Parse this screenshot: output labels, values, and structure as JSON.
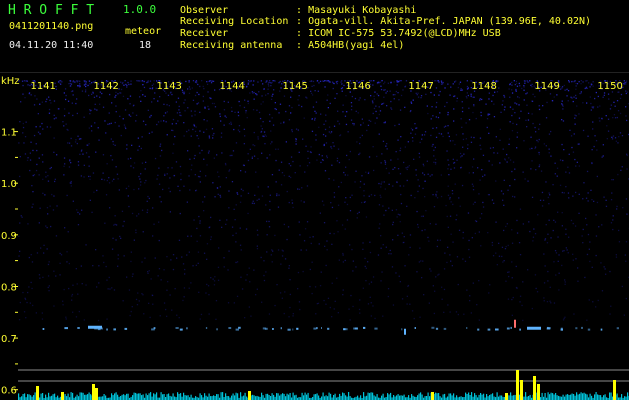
{
  "app": {
    "title": "H R O F F T",
    "version": "1.0.0",
    "filename": "0411201140.png",
    "datetime": "04.11.20 11:40",
    "count_label": "meteor",
    "count_value": "18"
  },
  "info": [
    {
      "label": "Observer",
      "sep": ":",
      "value": "Masayuki Kobayashi"
    },
    {
      "label": "Receiving Location",
      "sep": ":",
      "value": "Ogata-vill. Akita-Pref. JAPAN (139.96E, 40.02N)"
    },
    {
      "label": "Receiver",
      "sep": ":",
      "value": "ICOM IC-575 53.7492(@LCD)MHz USB"
    },
    {
      "label": "Receiving antenna",
      "sep": ":",
      "value": "A504HB(yagi 4el)"
    }
  ],
  "spectrogram": {
    "y_unit": "kHz",
    "y_ticks": [
      "1.1",
      "1.0",
      "0.9",
      "0.8",
      "0.7",
      "0.6"
    ],
    "y_tick_values": [
      1.1,
      1.0,
      0.9,
      0.8,
      0.7,
      0.6
    ],
    "x_ticks": [
      "1141",
      "1142",
      "1143",
      "1144",
      "1145",
      "1146",
      "1147",
      "1148",
      "1149",
      "1150"
    ],
    "x_tick_values": [
      1141,
      1142,
      1143,
      1144,
      1145,
      1146,
      1147,
      1148,
      1149,
      1150
    ],
    "x_range": [
      1140.6,
      1150.3
    ],
    "y_range": [
      0.58,
      1.2
    ],
    "colors": {
      "label": "#ffff33",
      "noise": "#2828c8",
      "echo": "#5fb4ff",
      "trace": "#00e5ff",
      "peak": "#ffff00"
    }
  }
}
